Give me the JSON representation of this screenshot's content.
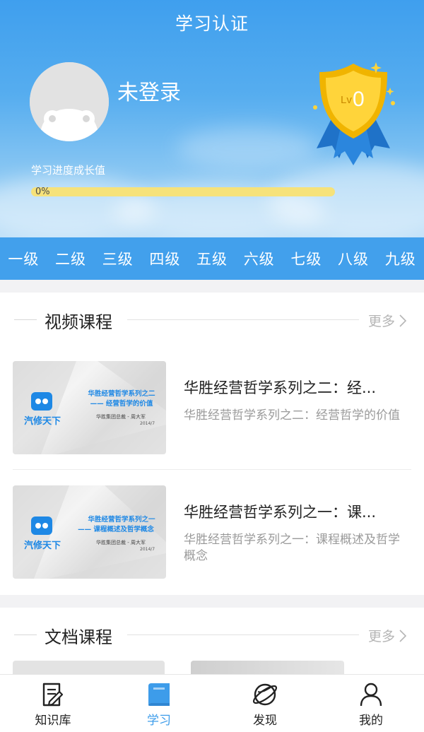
{
  "header": {
    "title": "学习认证",
    "username": "未登录",
    "progress_label": "学习进度成长值",
    "progress_text": "0%",
    "progress_value": 0,
    "badge_level_prefix": "Lv",
    "badge_level_number": "0"
  },
  "levels": [
    "一级",
    "二级",
    "三级",
    "四级",
    "五级",
    "六级",
    "七级",
    "八级",
    "九级"
  ],
  "video_section": {
    "title": "视频课程",
    "more": "更多",
    "courses": [
      {
        "title": "华胜经营哲学系列之二：经...",
        "description": "华胜经营哲学系列之二：经营哲学的价值",
        "thumb_brand": "汽修天下",
        "thumb_line1": "华胜经营哲学系列之二",
        "thumb_line2": "—— 经营哲学的价值",
        "thumb_author": "华胜集团总裁 - 周大军",
        "thumb_date": "2014/7"
      },
      {
        "title": "华胜经营哲学系列之一：课...",
        "description": "华胜经营哲学系列之一：课程概述及哲学概念",
        "thumb_brand": "汽修天下",
        "thumb_line1": "华胜经营哲学系列之一",
        "thumb_line2": "—— 课程概述及哲学概念",
        "thumb_author": "华胜集团总裁 - 周大军",
        "thumb_date": "2014/7"
      }
    ]
  },
  "doc_section": {
    "title": "文档课程",
    "more": "更多"
  },
  "tabbar": {
    "tabs": [
      {
        "label": "知识库",
        "icon": "document-edit-icon"
      },
      {
        "label": "学习",
        "icon": "book-icon"
      },
      {
        "label": "发现",
        "icon": "planet-icon"
      },
      {
        "label": "我的",
        "icon": "person-icon"
      }
    ],
    "active_index": 1
  },
  "colors": {
    "primary": "#42a0ec",
    "accent_yellow": "#f2c400",
    "tab_active": "#3d9cea"
  }
}
